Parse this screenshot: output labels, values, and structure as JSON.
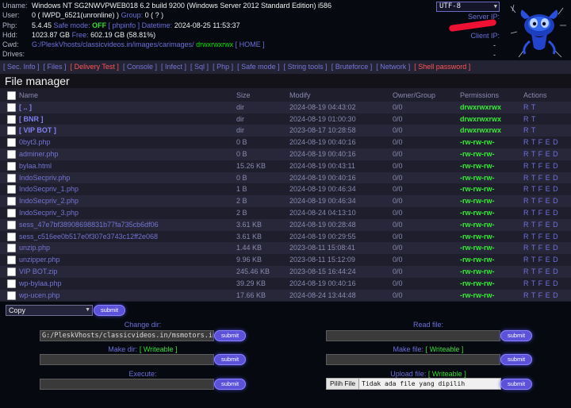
{
  "header": {
    "uname_label": "Uname:",
    "uname_value": "Windows NT SG2NWVPWEB018 6.2 build 9200 (Windows Server 2012 Standard Edition) i586",
    "user_label": "User:",
    "user_value": "0 ( IWPD_6521(unronline) )",
    "group_label": "Group:",
    "group_value": "0 ( ? )",
    "php_label": "Php:",
    "php_version": "5.4.45",
    "safe_mode_label": "Safe mode:",
    "safe_mode_value": "OFF",
    "phpinfo_link": "[ phpinfo ]",
    "datetime_label": "Datetime:",
    "datetime_value": "2024-08-25 11:53:37",
    "hdd_label": "Hdd:",
    "hdd_total": "1023.87 GB",
    "hdd_free_label": "Free:",
    "hdd_free": "602.19 GB (58.81%)",
    "cwd_label": "Cwd:",
    "cwd_path": "G:/PleskVhosts/classicvideos.in/images/carimages/",
    "cwd_perm": "drwxrwxrwx",
    "home_link": "[ HOME ]",
    "drives_label": "Drives:",
    "charset_selected": "UTF-8",
    "server_ip_label": "Server IP:",
    "server_ip_value": "—",
    "client_ip_label": "Client IP:",
    "dash1": "-",
    "dash2": "-"
  },
  "menu": [
    {
      "label": "[ Sec. Info ]",
      "style": "normal"
    },
    {
      "label": "[ Files ]",
      "style": "normal"
    },
    {
      "label": "[ Delivery Test ]",
      "style": "red"
    },
    {
      "label": "[ Console ]",
      "style": "normal"
    },
    {
      "label": "[ Infect ]",
      "style": "normal"
    },
    {
      "label": "[ Sql ]",
      "style": "normal"
    },
    {
      "label": "[ Php ]",
      "style": "normal"
    },
    {
      "label": "[ Safe mode ]",
      "style": "normal"
    },
    {
      "label": "[ String tools ]",
      "style": "normal"
    },
    {
      "label": "[ Bruteforce ]",
      "style": "normal"
    },
    {
      "label": "[ Network ]",
      "style": "normal"
    },
    {
      "label": "[ Shell password ]",
      "style": "red"
    }
  ],
  "file_manager": {
    "title": "File manager",
    "columns": {
      "name": "Name",
      "size": "Size",
      "modify": "Modify",
      "owner": "Owner/Group",
      "perms": "Permissions",
      "actions": "Actions"
    },
    "rows": [
      {
        "name": "[ .. ]",
        "is_dir": true,
        "size": "dir",
        "modify": "2024-08-19 04:43:02",
        "owner": "0/0",
        "perms": "drwxrwxrwx",
        "actions": "R T"
      },
      {
        "name": "[ BNR ]",
        "is_dir": true,
        "size": "dir",
        "modify": "2024-08-19 01:00:30",
        "owner": "0/0",
        "perms": "drwxrwxrwx",
        "actions": "R T"
      },
      {
        "name": "[ VIP BOT ]",
        "is_dir": true,
        "size": "dir",
        "modify": "2023-08-17 10:28:58",
        "owner": "0/0",
        "perms": "drwxrwxrwx",
        "actions": "R T"
      },
      {
        "name": "0byt3.php",
        "is_dir": false,
        "size": "0 B",
        "modify": "2024-08-19 00:40:16",
        "owner": "0/0",
        "perms": "-rw-rw-rw-",
        "actions": "R T F E D"
      },
      {
        "name": "adminer.php",
        "is_dir": false,
        "size": "0 B",
        "modify": "2024-08-19 00:40:16",
        "owner": "0/0",
        "perms": "-rw-rw-rw-",
        "actions": "R T F E D"
      },
      {
        "name": "bylaa.html",
        "is_dir": false,
        "size": "15.26 KB",
        "modify": "2024-08-19 00:43:11",
        "owner": "0/0",
        "perms": "-rw-rw-rw-",
        "actions": "R T F E D"
      },
      {
        "name": "IndoSecpriv.php",
        "is_dir": false,
        "size": "0 B",
        "modify": "2024-08-19 00:40:16",
        "owner": "0/0",
        "perms": "-rw-rw-rw-",
        "actions": "R T F E D"
      },
      {
        "name": "IndoSecpriv_1.php",
        "is_dir": false,
        "size": "1 B",
        "modify": "2024-08-19 00:46:34",
        "owner": "0/0",
        "perms": "-rw-rw-rw-",
        "actions": "R T F E D"
      },
      {
        "name": "IndoSecpriv_2.php",
        "is_dir": false,
        "size": "2 B",
        "modify": "2024-08-19 00:46:34",
        "owner": "0/0",
        "perms": "-rw-rw-rw-",
        "actions": "R T F E D"
      },
      {
        "name": "IndoSecpriv_3.php",
        "is_dir": false,
        "size": "2 B",
        "modify": "2024-08-24 04:13:10",
        "owner": "0/0",
        "perms": "-rw-rw-rw-",
        "actions": "R T F E D"
      },
      {
        "name": "sess_47e7bf38908698831b77fa735cb6df06",
        "is_dir": false,
        "size": "3.61 KB",
        "modify": "2024-08-19 00:28:48",
        "owner": "0/0",
        "perms": "-rw-rw-rw-",
        "actions": "R T F E D"
      },
      {
        "name": "sess_c516ee0b517e0f307e3743c12ff2e068",
        "is_dir": false,
        "size": "3.61 KB",
        "modify": "2024-08-19 00:29:55",
        "owner": "0/0",
        "perms": "-rw-rw-rw-",
        "actions": "R T F E D"
      },
      {
        "name": "unzip.php",
        "is_dir": false,
        "size": "1.44 KB",
        "modify": "2023-08-11 15:08:41",
        "owner": "0/0",
        "perms": "-rw-rw-rw-",
        "actions": "R T F E D"
      },
      {
        "name": "unzipper.php",
        "is_dir": false,
        "size": "9.96 KB",
        "modify": "2023-08-11 15:12:09",
        "owner": "0/0",
        "perms": "-rw-rw-rw-",
        "actions": "R T F E D"
      },
      {
        "name": "VIP BOT.zip",
        "is_dir": false,
        "size": "245.46 KB",
        "modify": "2023-08-15 16:44:24",
        "owner": "0/0",
        "perms": "-rw-rw-rw-",
        "actions": "R T F E D"
      },
      {
        "name": "wp-bylaa.php",
        "is_dir": false,
        "size": "39.29 KB",
        "modify": "2024-08-19 00:40:16",
        "owner": "0/0",
        "perms": "-rw-rw-rw-",
        "actions": "R T F E D"
      },
      {
        "name": "wp-ucen.php",
        "is_dir": false,
        "size": "17.66 KB",
        "modify": "2024-08-24 13:44:48",
        "owner": "0/0",
        "perms": "-rw-rw-rw-",
        "actions": "R T F E D"
      }
    ]
  },
  "bottom": {
    "copy_select": "Copy",
    "submit_label": "submit",
    "change_dir_label": "Change dir:",
    "change_dir_value": "G:/PleskVhosts/classicvideos.in/msmotors.in/images/carimages/",
    "read_file_label": "Read file:",
    "make_dir_label": "Make dir:",
    "writeable_label": "[ Writeable ]",
    "make_file_label": "Make file:",
    "execute_label": "Execute:",
    "upload_file_label": "Upload file:",
    "choose_file_button": "Pilih File",
    "no_file_text": "Tidak ada file yang dipilih"
  }
}
